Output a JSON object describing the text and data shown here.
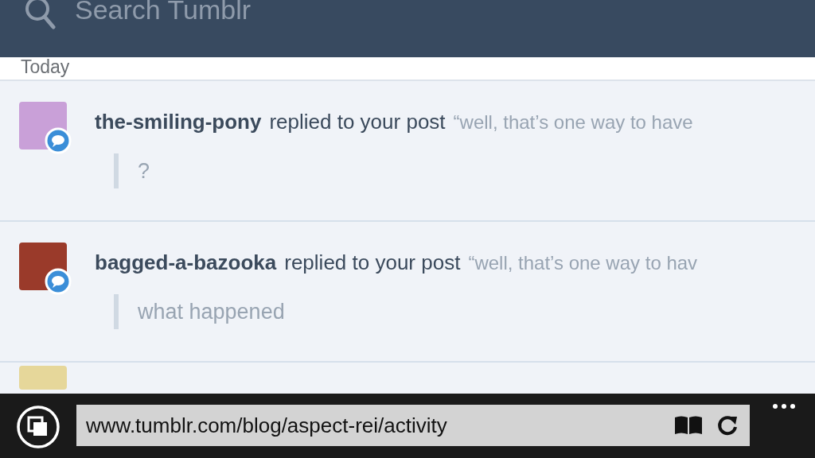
{
  "search": {
    "placeholder": "Search Tumblr"
  },
  "section_heading": "Today",
  "notifications": [
    {
      "username": "the-smiling-pony",
      "action": "replied to your post",
      "post_excerpt": "“well, that’s one way to have",
      "reply": "?"
    },
    {
      "username": "bagged-a-bazooka",
      "action": "replied to your post",
      "post_excerpt": "“well, that’s one way to hav",
      "reply": "what happened"
    }
  ],
  "address_bar": {
    "url": "www.tumblr.com/blog/aspect-rei/activity"
  }
}
